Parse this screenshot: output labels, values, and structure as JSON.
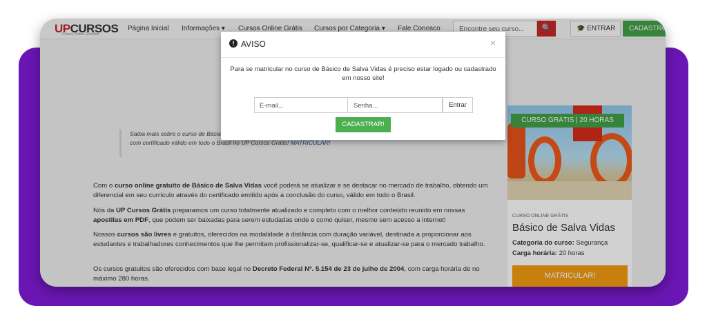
{
  "logo": {
    "part_a": "UP",
    "part_b": "CURSOS",
    "subtitle": "Cursos Online Gratuitos"
  },
  "nav": {
    "items": [
      "Página Inicial",
      "Informações ▾",
      "Cursos Online Grátis",
      "Cursos por Categoria ▾",
      "Fale Conosco"
    ],
    "search_placeholder": "Encontre seu curso...",
    "search_icon": "🔍",
    "entrar_label": "ENTRAR",
    "cadastro_label": "CADASTRO"
  },
  "modal": {
    "title": "AVISO",
    "message": "Para se matricular no curso de Básico de Salva Vidas é preciso estar logado ou cadastrado em nosso site!",
    "email_placeholder": "E-mail...",
    "senha_placeholder": "Senha...",
    "entrar_label": "Entrar",
    "cadastrar_label": "CADASTRAR!",
    "close_symbol": "×"
  },
  "quote": {
    "text": "Saiba mais sobre o curso de Básico de Salva Vidas e destaque-se com o nosso curso grátis online de Básico de Salva Vidas com certificado válido em todo o Brasil no UP Cursos Grátis!",
    "link": "MATRICULAR!"
  },
  "paragraphs": [
    {
      "pre": "Com o ",
      "b1": "curso online gratuito de Básico de Salva Vidas",
      "mid": " você poderá se atualizar e se destacar no mercado de trabalho, obtendo um diferencial em seu currículo através do certificado emitido após a conclusão do curso, válido em todo o Brasil.",
      "b2": "",
      "post": ""
    },
    {
      "pre": "Nós da ",
      "b1": "UP Cursos Grátis",
      "mid": " preparamos um curso totalmente atualizado e completo com o melhor conteúdo reunido em nossas ",
      "b2": "apostilas em PDF",
      "post": ", que podem ser baixadas para serem estudadas onde e como quiser, mesmo sem acesso a internet!"
    },
    {
      "pre": "Nossos ",
      "b1": "cursos são livres",
      "mid": " e gratuitos, oferecidos na modalidade à distância com duração variável, destinada a proporcionar aos estudantes e trabalhadores conhecimentos que lhe permitam profissionalizar-se, qualificar-se e atualizar-se para o mercado trabalho.",
      "b2": "",
      "post": ""
    },
    {
      "pre": "Os cursos gratuitos são oferecidos com base legal no ",
      "b1": "Decreto Federal Nº. 5.154 de 23 de julho de 2004",
      "mid": ", com carga horária de no máximo 280 horas.",
      "b2": "",
      "post": ""
    }
  ],
  "card": {
    "badge": "CURSO GRÁTIS | 20 HORAS",
    "label": "CURSO ONLINE GRÁTIS",
    "title": "Básico de Salva Vidas",
    "categoria_label": "Categoria do curso:",
    "categoria_value": "Segurança",
    "carga_label": "Carga horária:",
    "carga_value": "20 horas",
    "button_label": "MATRICULAR!"
  },
  "colors": {
    "brand_red": "#c62828",
    "green": "#43a047",
    "orange": "#f39c12",
    "purple": "#6a16b4"
  }
}
